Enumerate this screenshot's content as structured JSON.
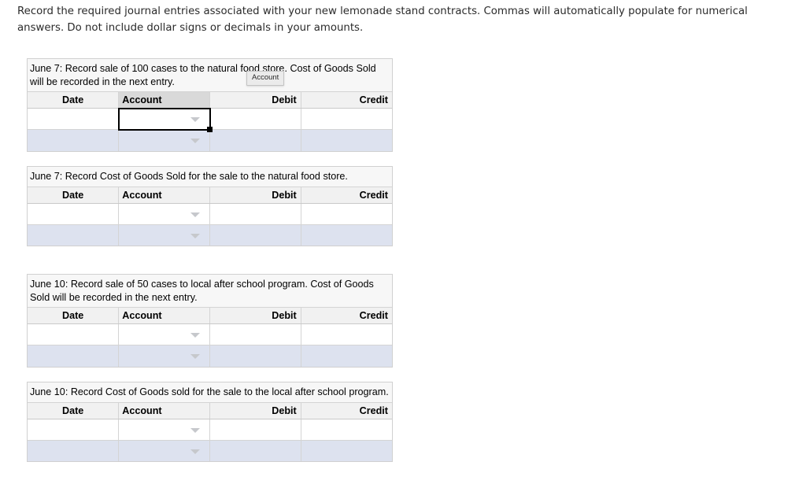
{
  "intro": {
    "text": "Record the required journal entries associated with your new lemonade stand contracts. Commas will automatically populate for numerical answers. Do not include dollar signs or decimals in your amounts."
  },
  "columns": {
    "date": "Date",
    "account": "Account",
    "debit": "Debit",
    "credit": "Credit"
  },
  "tooltip": {
    "label": "Account"
  },
  "tables": [
    {
      "caption": "June 7: Record sale of 100 cases to the natural food store. Cost of Goods Sold will be recorded in the next entry.",
      "rows": [
        {
          "date": "",
          "account": "",
          "debit": "",
          "credit": ""
        },
        {
          "date": "",
          "account": "",
          "debit": "",
          "credit": ""
        }
      ]
    },
    {
      "caption": "June 7: Record Cost of Goods Sold for the sale to the natural food store.",
      "rows": [
        {
          "date": "",
          "account": "",
          "debit": "",
          "credit": ""
        },
        {
          "date": "",
          "account": "",
          "debit": "",
          "credit": ""
        }
      ]
    },
    {
      "caption": "June 10: Record sale of 50 cases to local after school program. Cost of Goods Sold will be recorded in the next entry.",
      "rows": [
        {
          "date": "",
          "account": "",
          "debit": "",
          "credit": ""
        },
        {
          "date": "",
          "account": "",
          "debit": "",
          "credit": ""
        }
      ]
    },
    {
      "caption": "June 10: Record Cost of Goods sold for the sale to the local after school program.",
      "rows": [
        {
          "date": "",
          "account": "",
          "debit": "",
          "credit": ""
        },
        {
          "date": "",
          "account": "",
          "debit": "",
          "credit": ""
        }
      ]
    }
  ],
  "colors": {
    "header_bg": "#f1f1f1",
    "active_header_bg": "#d9d9d9",
    "alt_row_bg": "#dde2ef",
    "caption_bg": "#f7f7f7",
    "border": "#d4d4d4",
    "selection": "#000000"
  }
}
